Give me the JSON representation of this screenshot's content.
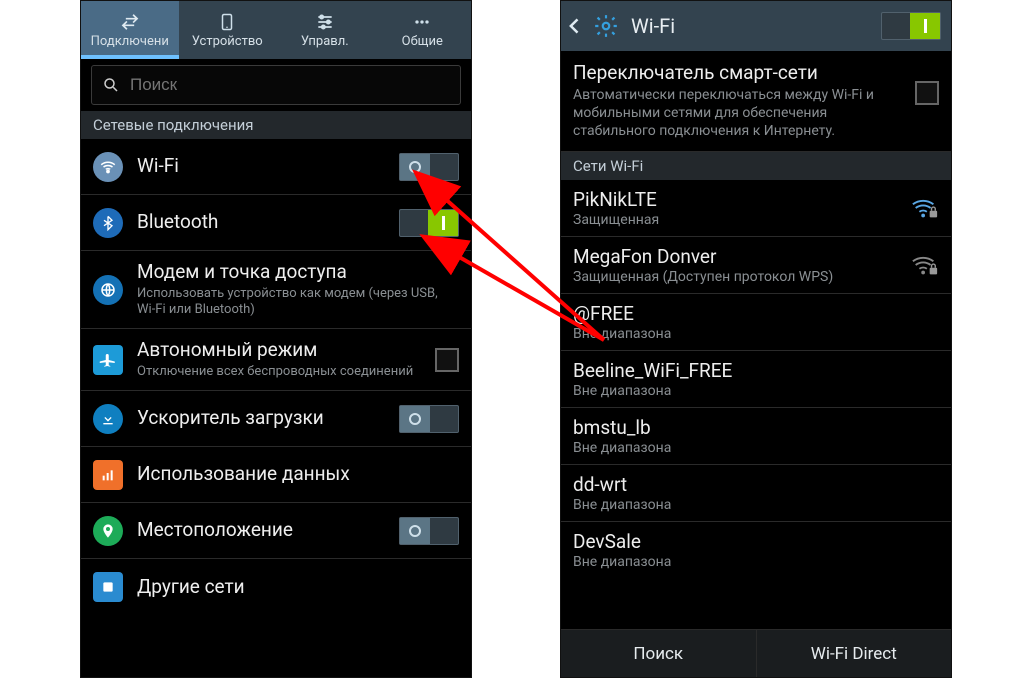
{
  "left": {
    "tabs": [
      {
        "label": "Подключени",
        "icon": "swap"
      },
      {
        "label": "Устройство",
        "icon": "phone"
      },
      {
        "label": "Управл.",
        "icon": "sliders"
      },
      {
        "label": "Общие",
        "icon": "more"
      }
    ],
    "active_tab": 0,
    "search_placeholder": "Поиск",
    "section_header": "Сетевые подключения",
    "rows": [
      {
        "icon": "wifi",
        "icon_bg": "#6a91b7",
        "title": "Wi-Fi",
        "toggle": "off"
      },
      {
        "icon": "bluetooth",
        "icon_bg": "#1e6bb8",
        "title": "Bluetooth",
        "toggle": "on"
      },
      {
        "icon": "globe",
        "icon_bg": "#1471b5",
        "icon_shape": "round",
        "title": "Модем и точка доступа",
        "sub": "Использовать устройство как модем (через USB, Wi-Fi или Bluetooth)"
      },
      {
        "icon": "plane",
        "icon_bg": "#1d9bd8",
        "icon_shape": "sq",
        "title": "Автономный режим",
        "sub": "Отключение всех беспроводных соединений",
        "checkbox": true
      },
      {
        "icon": "download",
        "icon_bg": "#0f7fc0",
        "title": "Ускоритель загрузки",
        "toggle": "off"
      },
      {
        "icon": "chart",
        "icon_bg": "#f0702a",
        "icon_shape": "sq",
        "title": "Использование данных"
      },
      {
        "icon": "location",
        "icon_bg": "#1dab58",
        "title": "Местоположение",
        "toggle": "off"
      },
      {
        "icon": "generic",
        "icon_bg": "#2a8bd0",
        "icon_shape": "sq",
        "title": "Другие сети"
      }
    ]
  },
  "right": {
    "title": "Wi-Fi",
    "toggle": "on",
    "smart": {
      "title": "Переключатель смарт-сети",
      "desc": "Автоматически переключаться между Wi-Fi и мобильными сетями для обеспечения стабильного подключения к Интернету."
    },
    "section_header": "Сети Wi-Fi",
    "networks": [
      {
        "name": "PikNikLTE",
        "sub": "Защищенная",
        "signal": true,
        "lock": true
      },
      {
        "name": "MegaFon Donver",
        "sub": "Защищенная (Доступен протокол WPS)",
        "signal": true,
        "lock": true
      },
      {
        "name": "@FREE",
        "sub": "Вне диапазона"
      },
      {
        "name": "Beeline_WiFi_FREE",
        "sub": "Вне диапазона"
      },
      {
        "name": "bmstu_lb",
        "sub": "Вне диапазона"
      },
      {
        "name": "dd-wrt",
        "sub": "Вне диапазона"
      },
      {
        "name": "DevSale",
        "sub": "Вне диапазона"
      }
    ],
    "bottom": {
      "search": "Поиск",
      "direct": "Wi-Fi Direct"
    }
  }
}
